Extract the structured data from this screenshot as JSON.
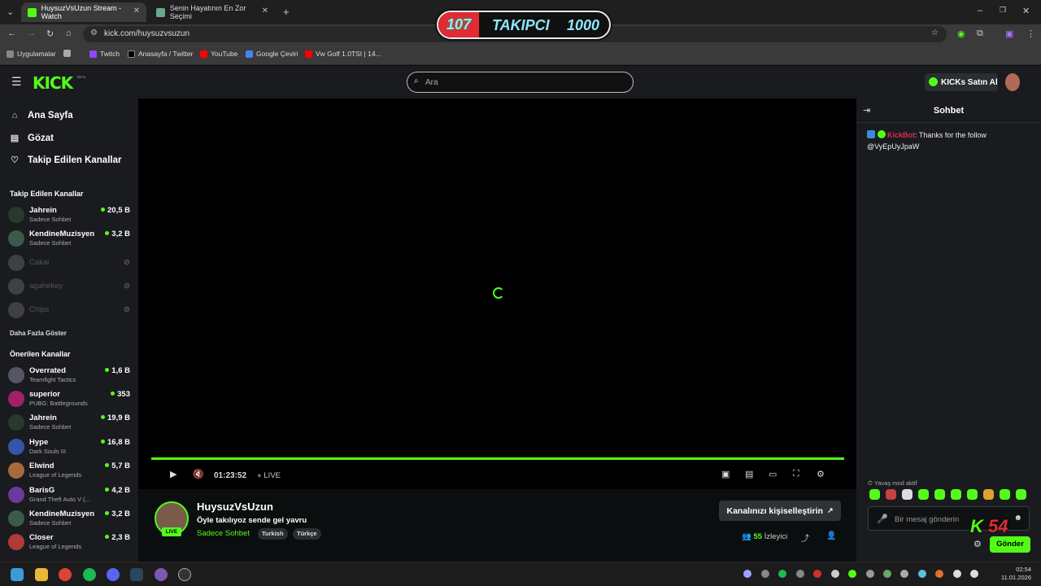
{
  "browser": {
    "tabs": [
      {
        "title": "HuysuzVsUzun Stream - Watch",
        "active": true
      },
      {
        "title": "Senin Hayatının En Zor Seçimi",
        "active": false
      }
    ],
    "url": "kick.com/huysuzvsuzun",
    "bookmarks": [
      "Uygulamalar",
      "Twitch",
      "Anasayfa / Twitter",
      "YouTube",
      "Google Çeviri",
      "Vw Golf 1.0TSI | 14..."
    ]
  },
  "overlay": {
    "current": "107",
    "label": "TAKIPCI",
    "goal": "1000"
  },
  "header": {
    "logo": "KICK",
    "beta": "BETA",
    "search_placeholder": "Ara",
    "kicks_button": "KICKs Satın Al"
  },
  "nav": [
    {
      "label": "Ana Sayfa",
      "icon": "home-icon"
    },
    {
      "label": "Gözat",
      "icon": "browse-icon"
    },
    {
      "label": "Takip Edilen Kanallar",
      "icon": "heart-icon"
    }
  ],
  "followed": {
    "heading": "Takip Edilen Kanallar",
    "channels": [
      {
        "name": "Jahrein",
        "sub": "Sadece Sohbet",
        "count": "20,5 B"
      },
      {
        "name": "KendineMuzisyen",
        "sub": "Sadece Sohbet",
        "count": "3,2 B"
      },
      {
        "name": "Cakal",
        "sub": "",
        "count": ""
      },
      {
        "name": "agahekey",
        "sub": "",
        "count": ""
      },
      {
        "name": "Chips",
        "sub": "",
        "count": ""
      }
    ],
    "show_more": "Daha Fazla Göster"
  },
  "recommended": {
    "heading": "Önerilen Kanallar",
    "channels": [
      {
        "name": "Overrated",
        "sub": "Teamfight Tactics",
        "count": "1,6 B"
      },
      {
        "name": "superior",
        "sub": "PUBG: Battlegrounds",
        "count": "353"
      },
      {
        "name": "Jahrein",
        "sub": "Sadece Sohbet",
        "count": "19,9 B"
      },
      {
        "name": "Hype",
        "sub": "Dark Souls III",
        "count": "16,8 B"
      },
      {
        "name": "Elwind",
        "sub": "League of Legends",
        "count": "5,7 B"
      },
      {
        "name": "BarisG",
        "sub": "Grand Theft Auto V (...",
        "count": "4,2 B"
      },
      {
        "name": "KendineMuzisyen",
        "sub": "Sadece Sohbet",
        "count": "3,2 B"
      },
      {
        "name": "Closer",
        "sub": "League of Legends",
        "count": "2,3 B"
      }
    ]
  },
  "player": {
    "time": "01:23:52",
    "live": "LIVE",
    "progress": 1.0
  },
  "stream": {
    "channel": "HuysuzVsUzun",
    "live_badge": "LIVE",
    "title": "Öyle takılıyoz sende gel yavru",
    "category": "Sadece Sohbet",
    "tags": [
      "Turkish",
      "Türkçe"
    ],
    "customize_button": "Kanalınızı kişiselleştirin",
    "viewers": "55",
    "viewers_label": "İzleyici"
  },
  "chat": {
    "title": "Sohbet",
    "message": {
      "user": "KickBot",
      "text": ": Thanks for the follow @VyEpUyJpaW"
    },
    "slow_mode": "Yavaş mod aktif",
    "input_placeholder": "Bir mesaj gönderin",
    "send": "Gönder"
  },
  "kick_badge": {
    "letter": "K",
    "number": "54"
  },
  "clock": {
    "time": "02:54",
    "date": "11.01.2026"
  },
  "colors": {
    "accent": "#53fc18",
    "bg": "#0b0e0f",
    "panel": "#191b1f",
    "overlay_red": "#e12a33"
  }
}
